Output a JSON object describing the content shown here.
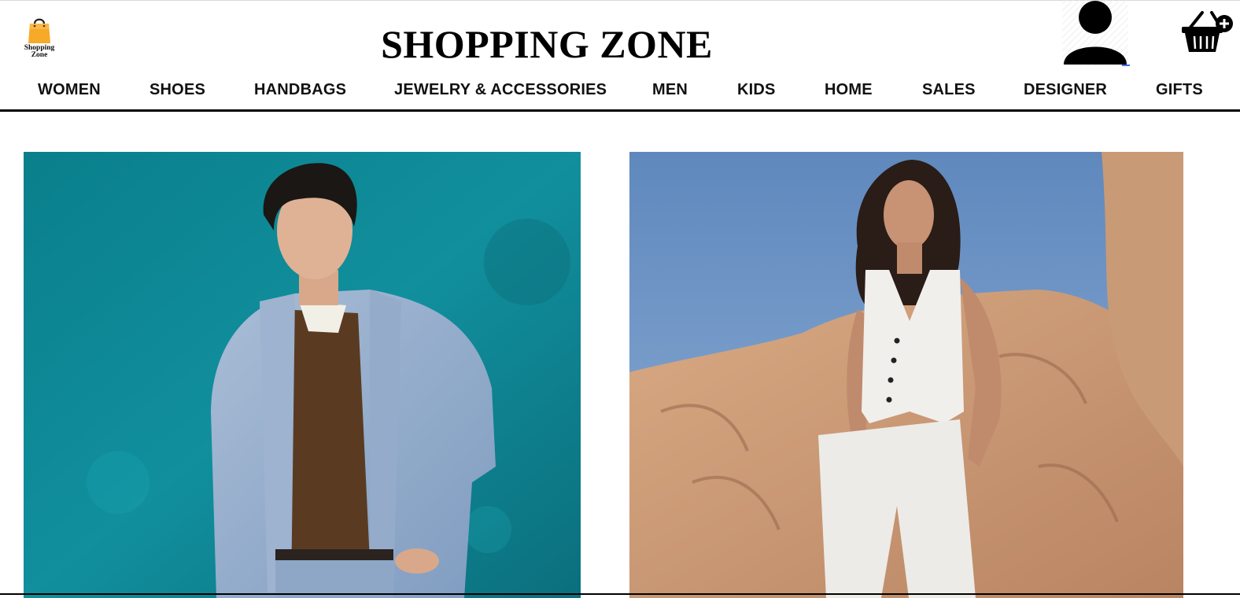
{
  "brand": {
    "logo_line1": "Shopping",
    "logo_line2": "Zone",
    "title": "SHOPPING ZONE",
    "accent_color": "#f7a928"
  },
  "header_icons": {
    "account": "user-account-icon",
    "cart": "shopping-basket-add-icon"
  },
  "nav": {
    "items": [
      {
        "label": "WOMEN"
      },
      {
        "label": "SHOES"
      },
      {
        "label": "HANDBAGS"
      },
      {
        "label": "JEWELRY & ACCESSORIES"
      },
      {
        "label": "MEN"
      },
      {
        "label": "KIDS"
      },
      {
        "label": "HOME"
      },
      {
        "label": "SALES"
      },
      {
        "label": "DESIGNER"
      },
      {
        "label": "GIFTS"
      }
    ]
  },
  "hero": {
    "tiles": [
      {
        "subject": "man in denim shirt against teal wall",
        "bg_color": "#0f8a98"
      },
      {
        "subject": "woman in white vest and trousers among desert rocks",
        "bg_color": "#6d93c2"
      }
    ]
  }
}
